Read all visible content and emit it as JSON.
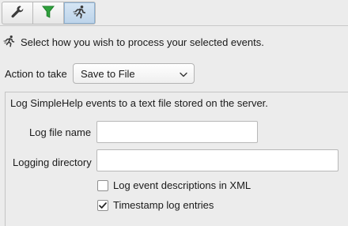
{
  "toolbar": {
    "buttons": [
      {
        "name": "wrench-icon",
        "active": false
      },
      {
        "name": "filter-icon",
        "active": false
      },
      {
        "name": "runner-icon",
        "active": true
      }
    ]
  },
  "intro": {
    "icon": "runner-icon",
    "text": "Select how you wish to process your selected events."
  },
  "action": {
    "label": "Action to take",
    "selected": "Save to File"
  },
  "group": {
    "description": "Log SimpleHelp events to a text file stored on the server.",
    "log_file_name": {
      "label": "Log file name",
      "value": ""
    },
    "logging_directory": {
      "label": "Logging directory",
      "value": ""
    },
    "xml_checkbox": {
      "label": "Log event descriptions in XML",
      "checked": false
    },
    "timestamp_checkbox": {
      "label": "Timestamp log entries",
      "checked": true
    }
  },
  "colors": {
    "accent": "#1f8f2e",
    "icon": "#3a3a3a"
  }
}
